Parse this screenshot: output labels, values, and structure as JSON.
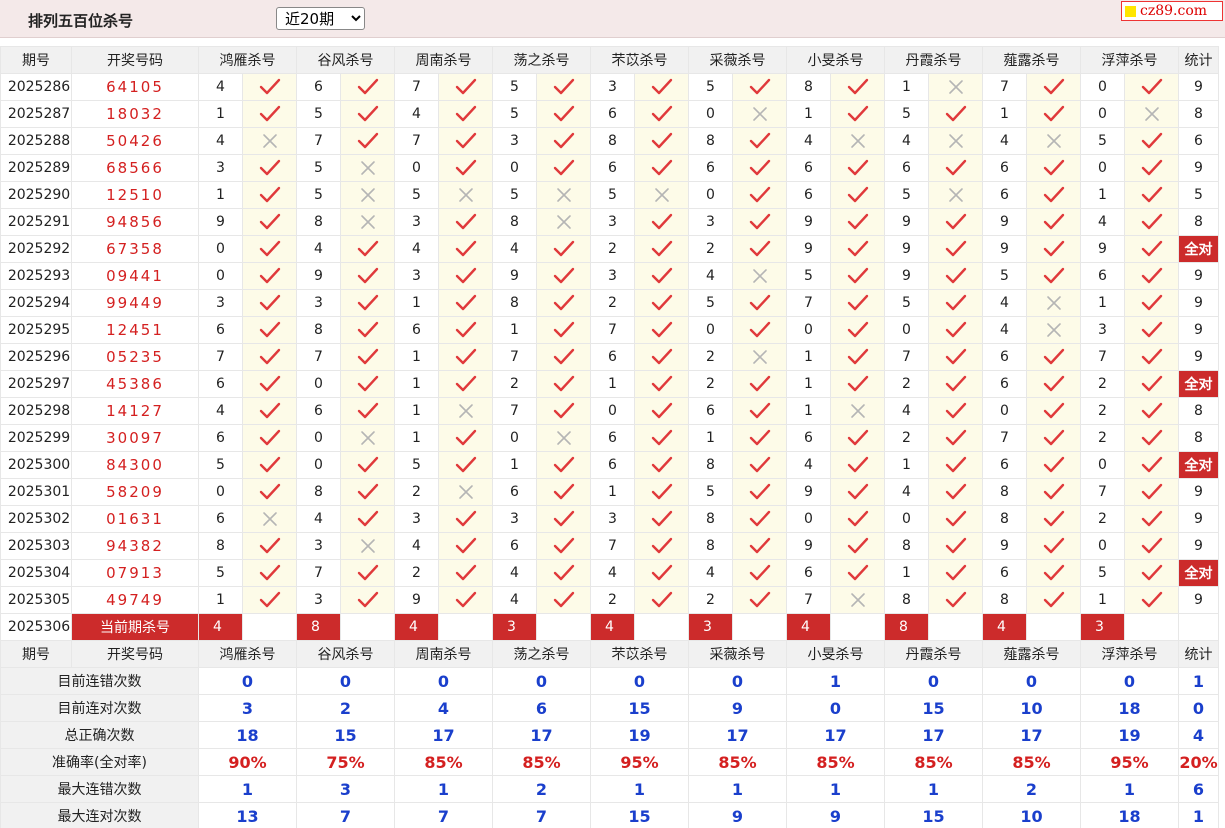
{
  "header": {
    "title": "排列五百位杀号",
    "range_select": "近20期",
    "logo_text": "cz89.com"
  },
  "columns": {
    "period": "期号",
    "draw": "开奖号码",
    "experts": [
      "鸿雁杀号",
      "谷风杀号",
      "周南杀号",
      "荡之杀号",
      "芣苡杀号",
      "采薇杀号",
      "小旻杀号",
      "丹霞杀号",
      "薤露杀号",
      "浮萍杀号"
    ],
    "stat": "统计"
  },
  "rows": [
    {
      "period": "2025286",
      "draw": "64105",
      "vals": [
        4,
        6,
        7,
        5,
        3,
        5,
        8,
        1,
        7,
        0
      ],
      "ok": [
        1,
        1,
        1,
        1,
        1,
        1,
        1,
        0,
        1,
        1
      ],
      "stat": "9"
    },
    {
      "period": "2025287",
      "draw": "18032",
      "vals": [
        1,
        5,
        4,
        5,
        6,
        0,
        1,
        5,
        1,
        0
      ],
      "ok": [
        1,
        1,
        1,
        1,
        1,
        0,
        1,
        1,
        1,
        0
      ],
      "stat": "8"
    },
    {
      "period": "2025288",
      "draw": "50426",
      "vals": [
        4,
        7,
        7,
        3,
        8,
        8,
        4,
        4,
        4,
        5
      ],
      "ok": [
        0,
        1,
        1,
        1,
        1,
        1,
        0,
        0,
        0,
        1
      ],
      "stat": "6"
    },
    {
      "period": "2025289",
      "draw": "68566",
      "vals": [
        3,
        5,
        0,
        0,
        6,
        6,
        6,
        6,
        6,
        0
      ],
      "ok": [
        1,
        0,
        1,
        1,
        1,
        1,
        1,
        1,
        1,
        1
      ],
      "stat": "9"
    },
    {
      "period": "2025290",
      "draw": "12510",
      "vals": [
        1,
        5,
        5,
        5,
        5,
        0,
        6,
        5,
        6,
        1
      ],
      "ok": [
        1,
        0,
        0,
        0,
        0,
        1,
        1,
        0,
        1,
        1
      ],
      "stat": "5"
    },
    {
      "period": "2025291",
      "draw": "94856",
      "vals": [
        9,
        8,
        3,
        8,
        3,
        3,
        9,
        9,
        9,
        4
      ],
      "ok": [
        1,
        0,
        1,
        0,
        1,
        1,
        1,
        1,
        1,
        1
      ],
      "stat": "8"
    },
    {
      "period": "2025292",
      "draw": "67358",
      "vals": [
        0,
        4,
        4,
        4,
        2,
        2,
        9,
        9,
        9,
        9
      ],
      "ok": [
        1,
        1,
        1,
        1,
        1,
        1,
        1,
        1,
        1,
        1
      ],
      "stat": "全对"
    },
    {
      "period": "2025293",
      "draw": "09441",
      "vals": [
        0,
        9,
        3,
        9,
        3,
        4,
        5,
        9,
        5,
        6
      ],
      "ok": [
        1,
        1,
        1,
        1,
        1,
        0,
        1,
        1,
        1,
        1
      ],
      "stat": "9"
    },
    {
      "period": "2025294",
      "draw": "99449",
      "vals": [
        3,
        3,
        1,
        8,
        2,
        5,
        7,
        5,
        4,
        1
      ],
      "ok": [
        1,
        1,
        1,
        1,
        1,
        1,
        1,
        1,
        0,
        1
      ],
      "stat": "9"
    },
    {
      "period": "2025295",
      "draw": "12451",
      "vals": [
        6,
        8,
        6,
        1,
        7,
        0,
        0,
        0,
        4,
        3
      ],
      "ok": [
        1,
        1,
        1,
        1,
        1,
        1,
        1,
        1,
        0,
        1
      ],
      "stat": "9"
    },
    {
      "period": "2025296",
      "draw": "05235",
      "vals": [
        7,
        7,
        1,
        7,
        6,
        2,
        1,
        7,
        6,
        7
      ],
      "ok": [
        1,
        1,
        1,
        1,
        1,
        0,
        1,
        1,
        1,
        1
      ],
      "stat": "9"
    },
    {
      "period": "2025297",
      "draw": "45386",
      "vals": [
        6,
        0,
        1,
        2,
        1,
        2,
        1,
        2,
        6,
        2
      ],
      "ok": [
        1,
        1,
        1,
        1,
        1,
        1,
        1,
        1,
        1,
        1
      ],
      "stat": "全对"
    },
    {
      "period": "2025298",
      "draw": "14127",
      "vals": [
        4,
        6,
        1,
        7,
        0,
        6,
        1,
        4,
        0,
        2
      ],
      "ok": [
        1,
        1,
        0,
        1,
        1,
        1,
        0,
        1,
        1,
        1
      ],
      "stat": "8"
    },
    {
      "period": "2025299",
      "draw": "30097",
      "vals": [
        6,
        0,
        1,
        0,
        6,
        1,
        6,
        2,
        7,
        2
      ],
      "ok": [
        1,
        0,
        1,
        0,
        1,
        1,
        1,
        1,
        1,
        1
      ],
      "stat": "8"
    },
    {
      "period": "2025300",
      "draw": "84300",
      "vals": [
        5,
        0,
        5,
        1,
        6,
        8,
        4,
        1,
        6,
        0
      ],
      "ok": [
        1,
        1,
        1,
        1,
        1,
        1,
        1,
        1,
        1,
        1
      ],
      "stat": "全对"
    },
    {
      "period": "2025301",
      "draw": "58209",
      "vals": [
        0,
        8,
        2,
        6,
        1,
        5,
        9,
        4,
        8,
        7
      ],
      "ok": [
        1,
        1,
        0,
        1,
        1,
        1,
        1,
        1,
        1,
        1
      ],
      "stat": "9"
    },
    {
      "period": "2025302",
      "draw": "01631",
      "vals": [
        6,
        4,
        3,
        3,
        3,
        8,
        0,
        0,
        8,
        2
      ],
      "ok": [
        0,
        1,
        1,
        1,
        1,
        1,
        1,
        1,
        1,
        1
      ],
      "stat": "9"
    },
    {
      "period": "2025303",
      "draw": "94382",
      "vals": [
        8,
        3,
        4,
        6,
        7,
        8,
        9,
        8,
        9,
        0
      ],
      "ok": [
        1,
        0,
        1,
        1,
        1,
        1,
        1,
        1,
        1,
        1
      ],
      "stat": "9"
    },
    {
      "period": "2025304",
      "draw": "07913",
      "vals": [
        5,
        7,
        2,
        4,
        4,
        4,
        6,
        1,
        6,
        5
      ],
      "ok": [
        1,
        1,
        1,
        1,
        1,
        1,
        1,
        1,
        1,
        1
      ],
      "stat": "全对"
    },
    {
      "period": "2025305",
      "draw": "49749",
      "vals": [
        1,
        3,
        9,
        4,
        2,
        2,
        7,
        8,
        8,
        1
      ],
      "ok": [
        1,
        1,
        1,
        1,
        1,
        1,
        0,
        1,
        1,
        1
      ],
      "stat": "9"
    }
  ],
  "current": {
    "period": "2025306",
    "label": "当前期杀号",
    "vals": [
      "4",
      "8",
      "4",
      "3",
      "4",
      "3",
      "4",
      "8",
      "4",
      "3"
    ]
  },
  "summary": [
    {
      "label": "目前连错次数",
      "vals": [
        "0",
        "0",
        "0",
        "0",
        "0",
        "0",
        "1",
        "0",
        "0",
        "0"
      ],
      "stat": "1",
      "red": false
    },
    {
      "label": "目前连对次数",
      "vals": [
        "3",
        "2",
        "4",
        "6",
        "15",
        "9",
        "0",
        "15",
        "10",
        "18"
      ],
      "stat": "0",
      "red": false
    },
    {
      "label": "总正确次数",
      "vals": [
        "18",
        "15",
        "17",
        "17",
        "19",
        "17",
        "17",
        "17",
        "17",
        "19"
      ],
      "stat": "4",
      "red": false
    },
    {
      "label": "准确率(全对率)",
      "vals": [
        "90%",
        "75%",
        "85%",
        "85%",
        "95%",
        "85%",
        "85%",
        "85%",
        "85%",
        "95%"
      ],
      "stat": "20%",
      "red": true
    },
    {
      "label": "最大连错次数",
      "vals": [
        "1",
        "3",
        "1",
        "2",
        "1",
        "1",
        "1",
        "1",
        "2",
        "1"
      ],
      "stat": "6",
      "red": false
    },
    {
      "label": "最大连对次数",
      "vals": [
        "13",
        "7",
        "7",
        "7",
        "15",
        "9",
        "9",
        "15",
        "10",
        "18"
      ],
      "stat": "1",
      "red": false
    }
  ],
  "colors": {
    "accent_red": "#cc2b2b",
    "check_red": "#e0393b",
    "cross_gray": "#b5b5b5",
    "summary_blue": "#1a3fcc",
    "mark_bg": "#fdfbe8"
  }
}
